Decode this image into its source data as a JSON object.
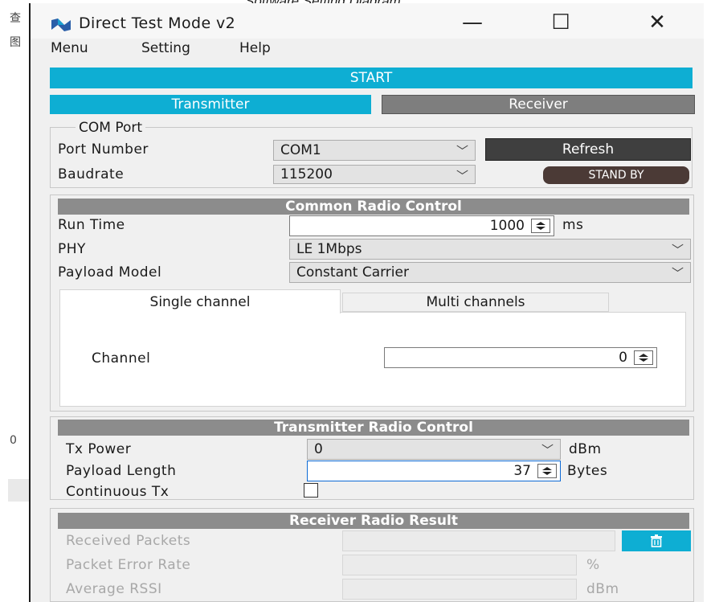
{
  "caption": "Software Setting Diagram",
  "background_gutter": [
    "查",
    "图",
    "0"
  ],
  "window": {
    "title": "Direct Test Mode v2",
    "controls": {
      "minimize": "—",
      "maximize": "☐",
      "close": "✕"
    }
  },
  "menu": [
    "Menu",
    "Setting",
    "Help"
  ],
  "start_label": "START",
  "mode_tabs": {
    "transmitter": "Transmitter",
    "receiver": "Receiver"
  },
  "com_port": {
    "legend": "COM Port",
    "port_number_label": "Port Number",
    "port_number_value": "COM1",
    "baudrate_label": "Baudrate",
    "baudrate_value": "115200",
    "refresh_label": "Refresh",
    "status": "STAND BY"
  },
  "common_radio": {
    "header": "Common Radio Control",
    "run_time_label": "Run Time",
    "run_time_value": "1000",
    "run_time_unit": "ms",
    "phy_label": "PHY",
    "phy_value": "LE 1Mbps",
    "payload_model_label": "Payload Model",
    "payload_model_value": "Constant Carrier",
    "channel_tabs": {
      "single": "Single channel",
      "multi": "Multi channels"
    },
    "channel_label": "Channel",
    "channel_value": "0"
  },
  "tx_radio": {
    "header": "Transmitter Radio Control",
    "tx_power_label": "Tx Power",
    "tx_power_value": "0",
    "tx_power_unit": "dBm",
    "payload_length_label": "Payload Length",
    "payload_length_value": "37",
    "payload_length_unit": "Bytes",
    "continuous_tx_label": "Continuous Tx"
  },
  "rx_result": {
    "header": "Receiver Radio Result",
    "received_packets_label": "Received Packets",
    "packet_error_rate_label": "Packet Error Rate",
    "packet_error_rate_unit": "%",
    "average_rssi_label": "Average RSSI",
    "average_rssi_unit": "dBm"
  },
  "colors": {
    "accent": "#0eaed3",
    "section_header": "#8c8c8c",
    "status_badge": "#4b3a36"
  }
}
